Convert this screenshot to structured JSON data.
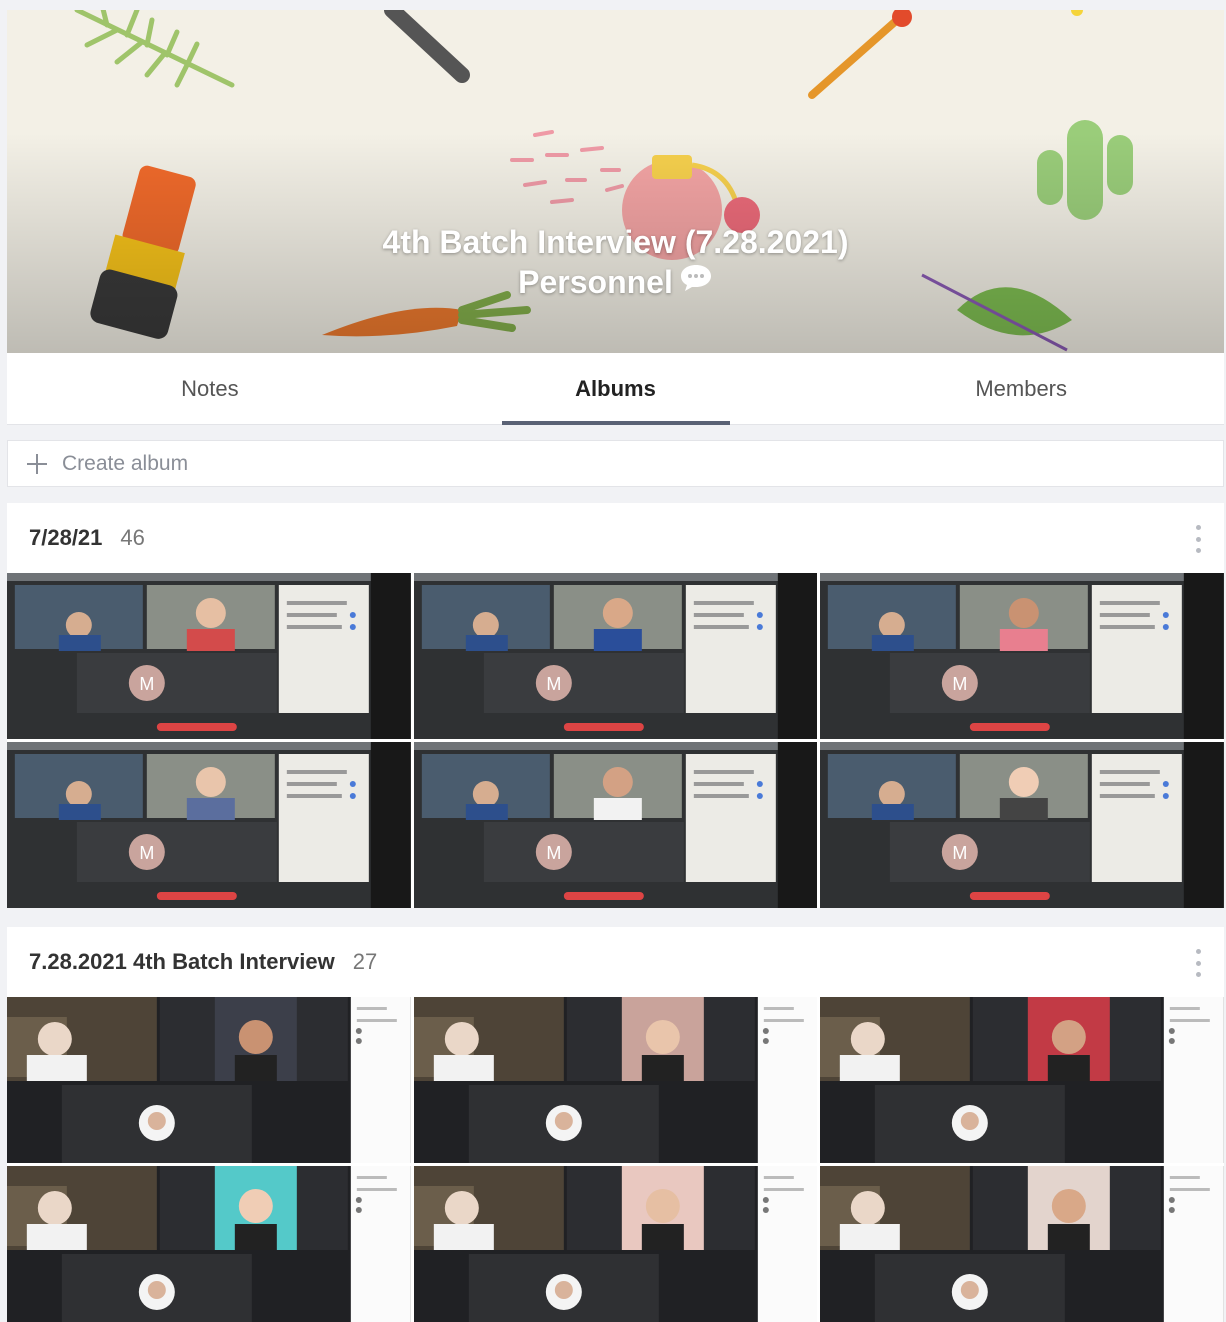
{
  "cover": {
    "title": "4th Batch Interview (7.28.2021)",
    "subtitle": "Personnel",
    "chat_icon": "chat-bubble-icon"
  },
  "tabs": [
    {
      "label": "Notes",
      "active": false
    },
    {
      "label": "Albums",
      "active": true
    },
    {
      "label": "Members",
      "active": false
    }
  ],
  "create_album": {
    "label": "Create album",
    "icon": "plus-icon"
  },
  "albums": [
    {
      "name": "7/28/21",
      "count": "46",
      "more_icon": "more-vertical-icon",
      "photos": [
        {
          "style": "meet",
          "avatar_letter": "M"
        },
        {
          "style": "meet",
          "avatar_letter": "M"
        },
        {
          "style": "meet",
          "avatar_letter": "M"
        },
        {
          "style": "meet",
          "avatar_letter": "M"
        },
        {
          "style": "meet",
          "avatar_letter": "M"
        },
        {
          "style": "meet",
          "avatar_letter": "M"
        }
      ]
    },
    {
      "name": "7.28.2021 4th Batch Interview",
      "count": "27",
      "more_icon": "more-vertical-icon",
      "photos": [
        {
          "style": "dark"
        },
        {
          "style": "dark"
        },
        {
          "style": "dark"
        },
        {
          "style": "dark"
        },
        {
          "style": "dark"
        },
        {
          "style": "dark"
        }
      ]
    }
  ],
  "colors": {
    "accent_underline": "#5a6275",
    "page_bg": "#f1f2f5",
    "avatar_circle": "#c9a49d"
  }
}
